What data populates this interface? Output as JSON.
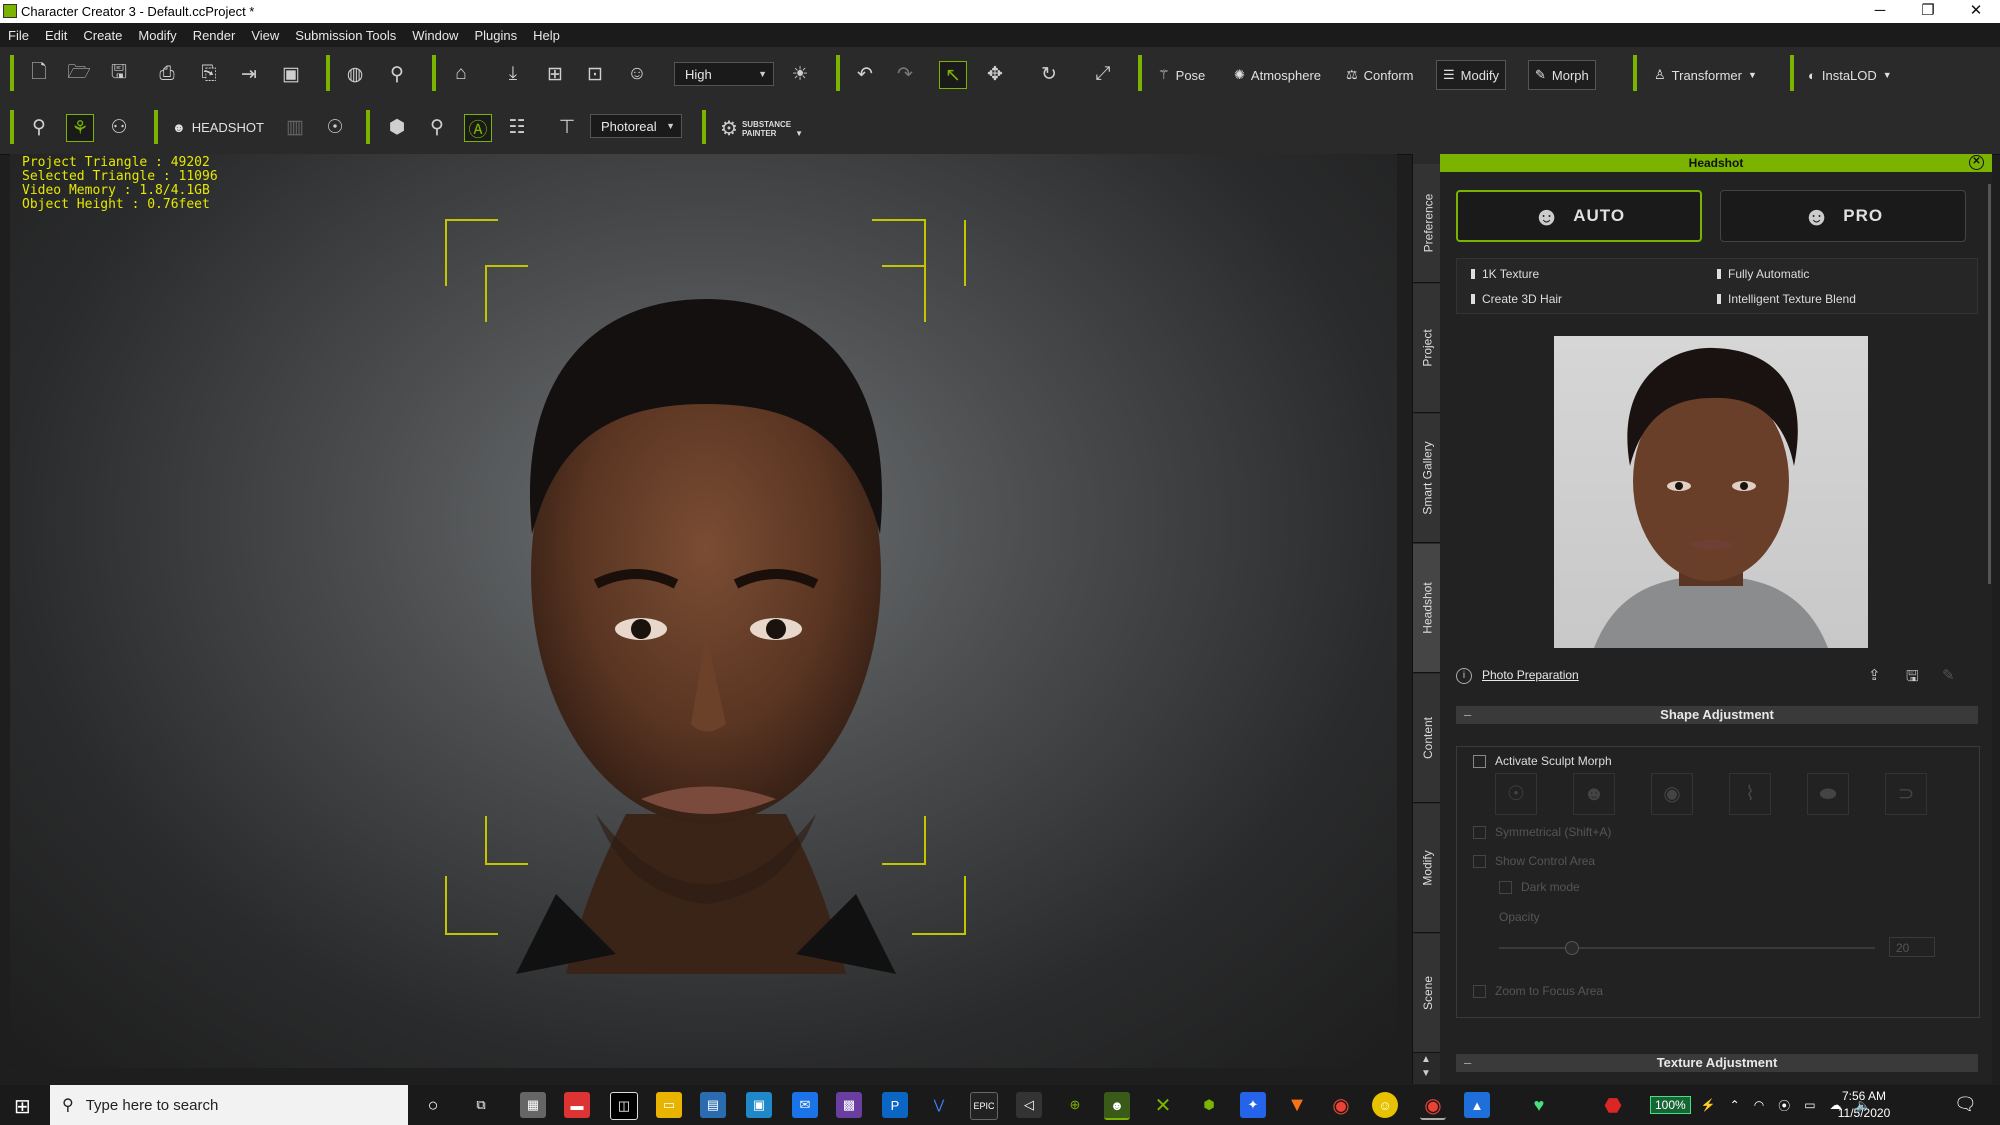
{
  "window": {
    "title": "Character Creator 3 - Default.ccProject *",
    "min": "─",
    "max": "❐",
    "close": "✕"
  },
  "menu": [
    "File",
    "Edit",
    "Create",
    "Modify",
    "Render",
    "View",
    "Submission Tools",
    "Window",
    "Plugins",
    "Help"
  ],
  "toolbar1": {
    "quality": "High",
    "buttons": {
      "pose": "Pose",
      "atmosphere": "Atmosphere",
      "conform": "Conform",
      "modify": "Modify",
      "morph": "Morph",
      "transformer": "Transformer",
      "instalod": "InstaLOD"
    }
  },
  "toolbar2": {
    "headshot": "HEADSHOT",
    "render_mode": "Photoreal",
    "substance_top": "SUBSTANCE",
    "substance_bottom": "PAINTER"
  },
  "viewport": {
    "stats": [
      "Project Triangle : 49202",
      "Selected Triangle : 11096",
      "Video Memory : 1.8/4.1GB",
      "Object Height : 0.76feet"
    ]
  },
  "side_tabs": [
    "Preference",
    "Project",
    "Smart Gallery",
    "Headshot",
    "Content",
    "Modify",
    "Scene"
  ],
  "panel": {
    "title": "Headshot",
    "auto_label": "AUTO",
    "pro_label": "PRO",
    "features": [
      "1K Texture",
      "Fully Automatic",
      "Create 3D Hair",
      "Intelligent Texture Blend"
    ],
    "photo_prep": "Photo Preparation",
    "shape_adjustment": "Shape Adjustment",
    "activate_sculpt": "Activate Sculpt Morph",
    "symmetrical": "Symmetrical (Shift+A)",
    "show_control": "Show Control Area",
    "dark_mode": "Dark mode",
    "opacity_label": "Opacity",
    "opacity_value": "20",
    "zoom_focus": "Zoom to Focus Area",
    "texture_adjustment": "Texture Adjustment"
  },
  "taskbar": {
    "search_placeholder": "Type here to search",
    "battery": "100%",
    "time": "7:56 AM",
    "date": "11/5/2020"
  },
  "colors": {
    "accent": "#7ab400",
    "stats_text": "#e5e800"
  }
}
